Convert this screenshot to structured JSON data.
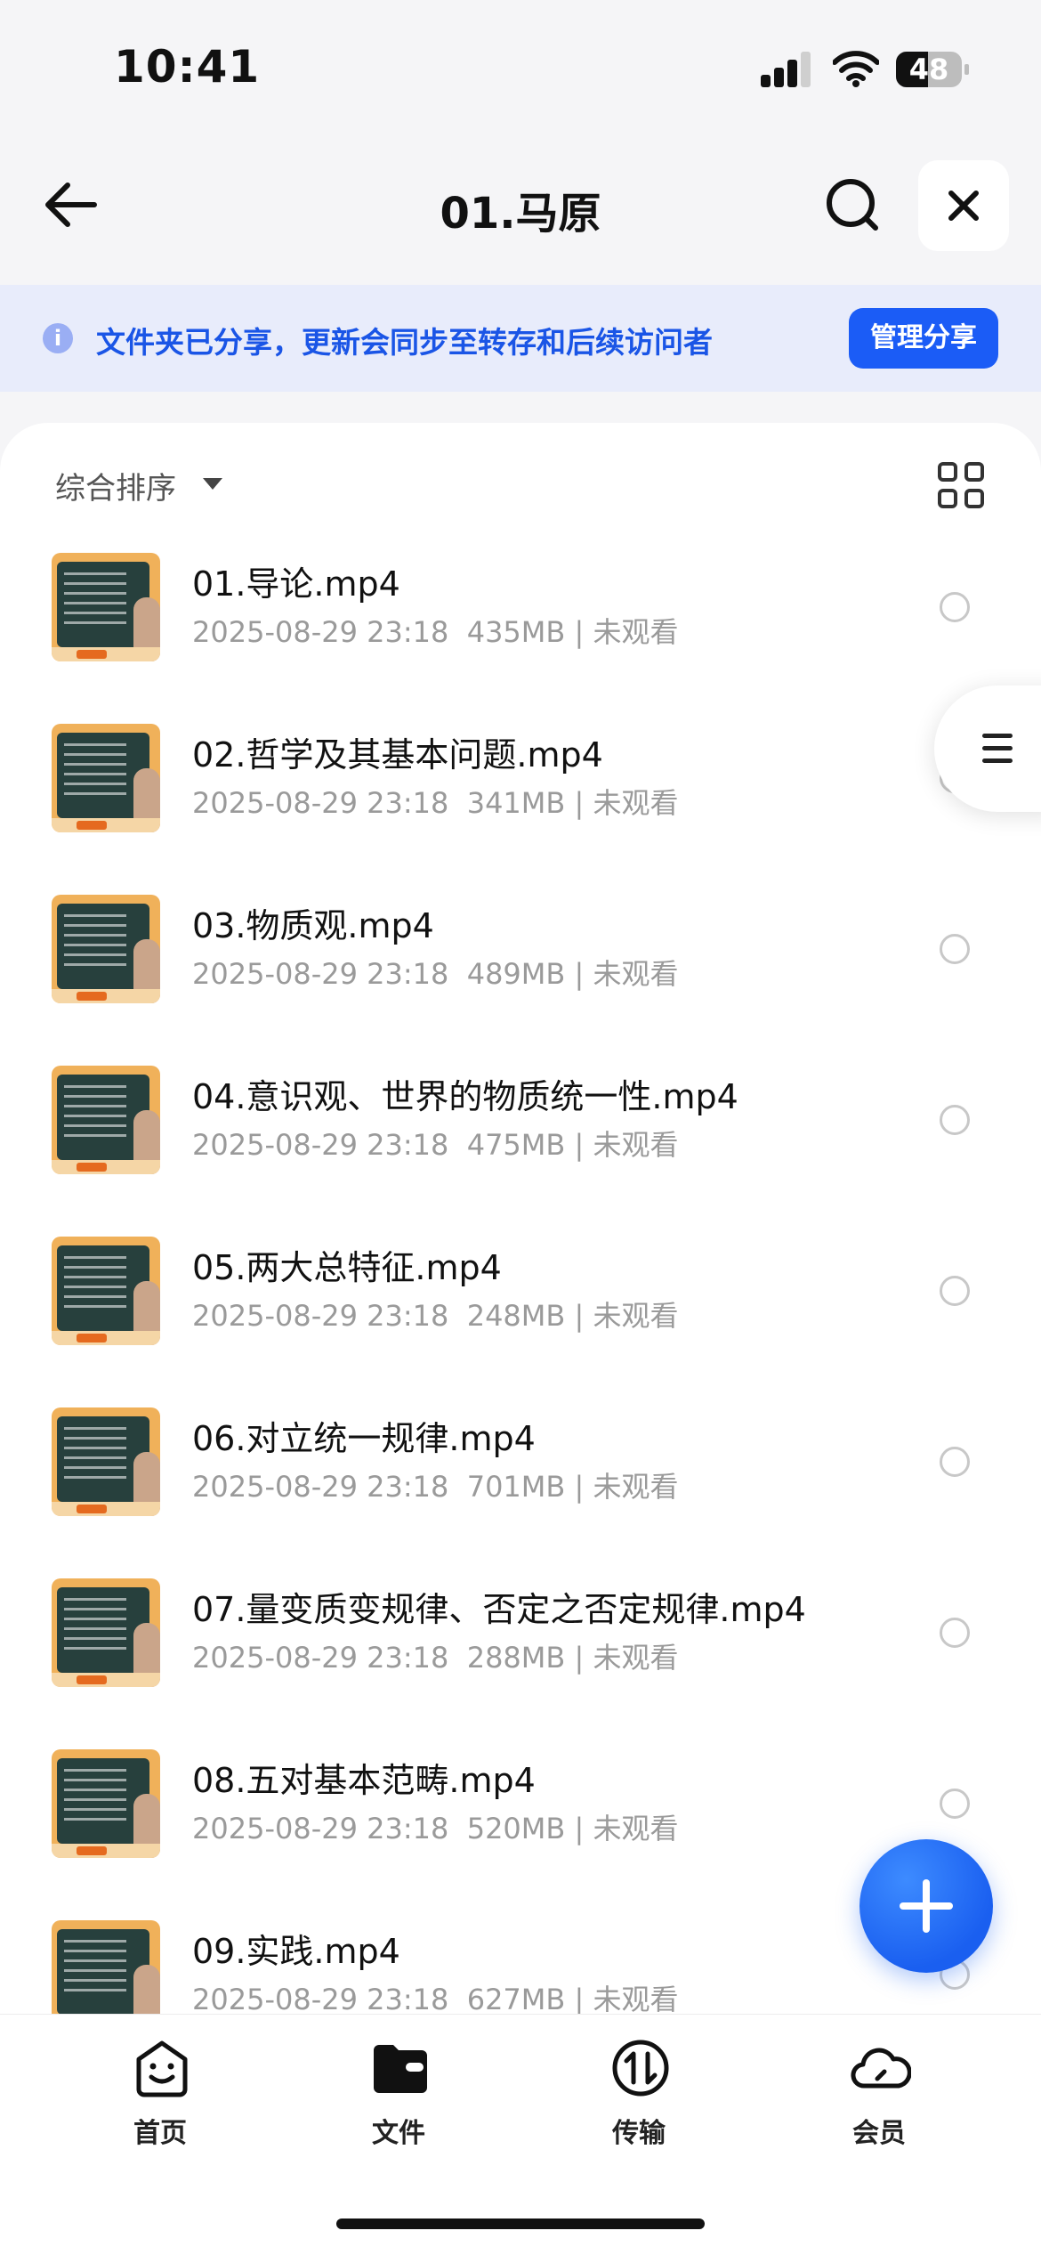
{
  "status": {
    "time": "10:41",
    "battery": 48
  },
  "nav": {
    "title": "01.马原"
  },
  "banner": {
    "text": "文件夹已分享，更新会同步至转存和后续访问者",
    "action": "管理分享"
  },
  "list": {
    "sort_label": "综合排序",
    "files": [
      {
        "name": "01.导论.mp4",
        "date": "2025-08-29 23:18",
        "size": "435MB",
        "status": "未观看"
      },
      {
        "name": "02.哲学及其基本问题.mp4",
        "date": "2025-08-29 23:18",
        "size": "341MB",
        "status": "未观看"
      },
      {
        "name": "03.物质观.mp4",
        "date": "2025-08-29 23:18",
        "size": "489MB",
        "status": "未观看"
      },
      {
        "name": "04.意识观、世界的物质统一性.mp4",
        "date": "2025-08-29 23:18",
        "size": "475MB",
        "status": "未观看"
      },
      {
        "name": "05.两大总特征.mp4",
        "date": "2025-08-29 23:18",
        "size": "248MB",
        "status": "未观看"
      },
      {
        "name": "06.对立统一规律.mp4",
        "date": "2025-08-29 23:18",
        "size": "701MB",
        "status": "未观看"
      },
      {
        "name": "07.量变质变规律、否定之否定规律.mp4",
        "date": "2025-08-29 23:18",
        "size": "288MB",
        "status": "未观看"
      },
      {
        "name": "08.五对基本范畴.mp4",
        "date": "2025-08-29 23:18",
        "size": "520MB",
        "status": "未观看"
      },
      {
        "name": "09.实践.mp4",
        "date": "2025-08-29 23:18",
        "size": "627MB",
        "status": "未观看"
      }
    ]
  },
  "tabs": [
    {
      "label": "首页",
      "icon": "smile-face-icon"
    },
    {
      "label": "文件",
      "icon": "folder-icon"
    },
    {
      "label": "传输",
      "icon": "transfer-icon"
    },
    {
      "label": "会员",
      "icon": "cloud-icon"
    }
  ],
  "colors": {
    "accent": "#1b5cf6",
    "banner_bg": "#e8ecfb",
    "meta_text": "#9a9a9a"
  }
}
